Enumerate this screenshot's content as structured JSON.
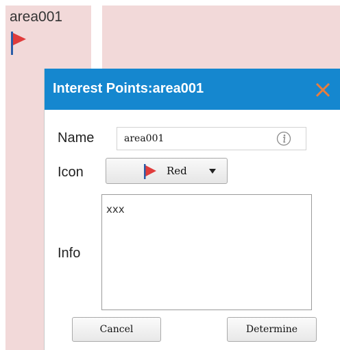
{
  "map": {
    "marker_label": "area001",
    "marker_icon": "red-flag-icon"
  },
  "dialog": {
    "title": "Interest Points:area001",
    "close_icon": "close-icon",
    "colors": {
      "titlebar": "#1587cf",
      "close": "#e87d3e",
      "background": "#f2d9d9"
    }
  },
  "form": {
    "name_label": "Name",
    "name_value": "area001",
    "icon_label": "Icon",
    "icon_selected": "Red",
    "info_label": "Info",
    "info_value": "xxx"
  },
  "buttons": {
    "cancel": "Cancel",
    "determine": "Determine"
  }
}
